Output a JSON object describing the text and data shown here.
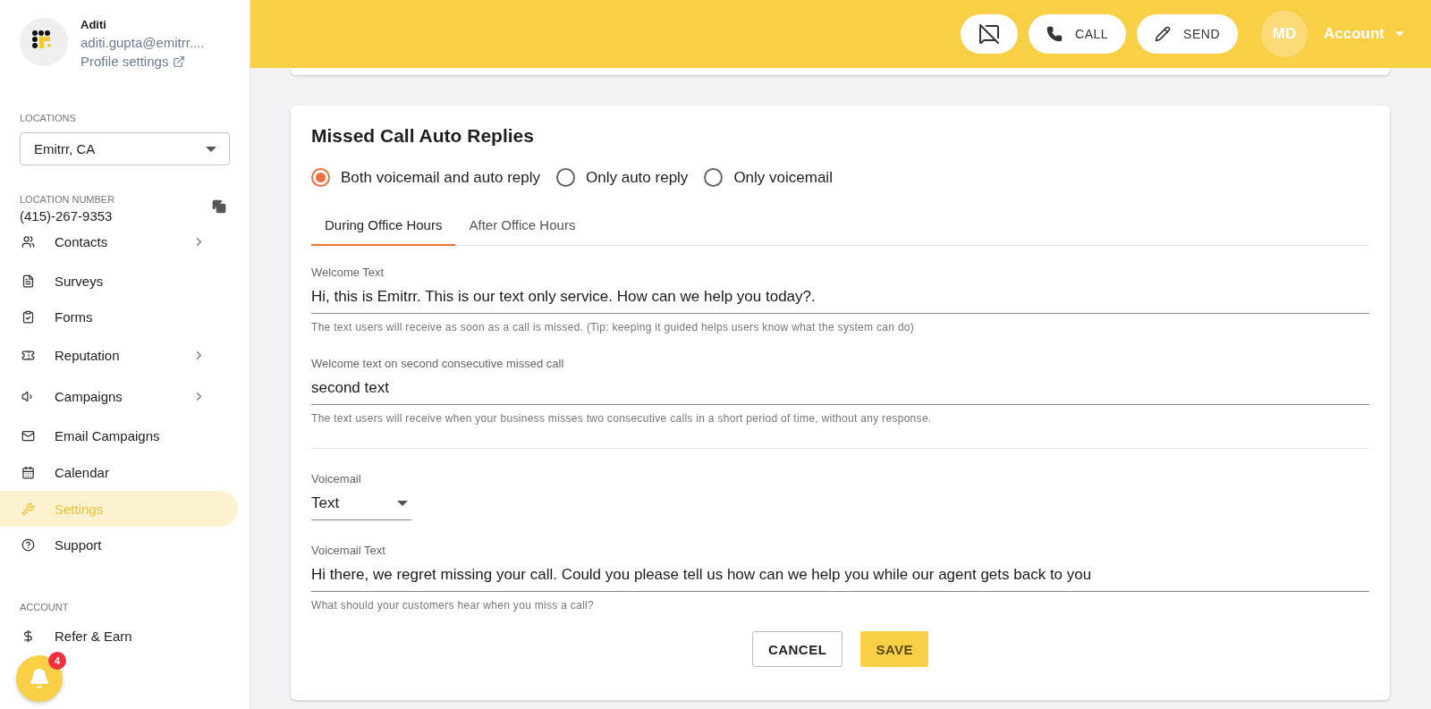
{
  "profile": {
    "name": "Aditi",
    "email": "aditi.gupta@emitrr....",
    "link": "Profile settings"
  },
  "locations": {
    "label": "LOCATIONS",
    "value": "Emitrr, CA"
  },
  "location_number": {
    "label": "LOCATION NUMBER",
    "value": "(415)-267-9353"
  },
  "nav": [
    {
      "label": "Contacts",
      "expandable": true,
      "selected": false
    },
    {
      "label": "Surveys",
      "expandable": false,
      "selected": false
    },
    {
      "label": "Forms",
      "expandable": false,
      "selected": false
    },
    {
      "label": "Reputation",
      "expandable": true,
      "selected": false
    },
    {
      "label": "Campaigns",
      "expandable": true,
      "selected": false
    },
    {
      "label": "Email Campaigns",
      "expandable": false,
      "selected": false
    },
    {
      "label": "Calendar",
      "expandable": false,
      "selected": false
    },
    {
      "label": "Settings",
      "expandable": false,
      "selected": true
    },
    {
      "label": "Support",
      "expandable": false,
      "selected": false
    }
  ],
  "account_section": {
    "label": "ACCOUNT",
    "items": [
      {
        "label": "Refer & Earn",
        "selected": false
      }
    ]
  },
  "notifications": {
    "count": "4"
  },
  "header": {
    "buttons": [
      {
        "kind": "icon"
      },
      {
        "kind": "call",
        "label": "CALL"
      },
      {
        "kind": "send",
        "label": "SEND"
      }
    ],
    "avatar": "MD",
    "account": "Account"
  },
  "card": {
    "title": "Missed Call Auto Replies",
    "options": [
      {
        "label": "Both voicemail and auto reply",
        "selected": true
      },
      {
        "label": "Only auto reply",
        "selected": false
      },
      {
        "label": "Only voicemail",
        "selected": false
      }
    ],
    "tabs": [
      {
        "label": "During Office Hours",
        "selected": true
      },
      {
        "label": "After Office Hours",
        "selected": false
      }
    ],
    "sections": [
      [
        {
          "kind": "text",
          "label": "Welcome Text",
          "value": "Hi, this is Emitrr. This is our text only service. How can we help you today?.",
          "helper": "The text users will receive as soon as a call is missed. (Tip: keeping it guided helps users know what the system can do)"
        },
        {
          "kind": "text",
          "label": "Welcome text on second consecutive missed call",
          "value": "second text",
          "helper": "The text users will receive when your business misses two consecutive calls in a short period of time, without any response."
        }
      ],
      [
        {
          "kind": "select",
          "label": "Voicemail",
          "value": "Text"
        },
        {
          "kind": "text",
          "label": "Voicemail Text",
          "value": "Hi there, we regret missing your call. Could you please tell us how can we help you while our agent gets back to you",
          "helper": "What should your customers hear when you miss a call?"
        }
      ]
    ],
    "actions": {
      "cancel": "CANCEL",
      "save": "SAVE"
    }
  }
}
